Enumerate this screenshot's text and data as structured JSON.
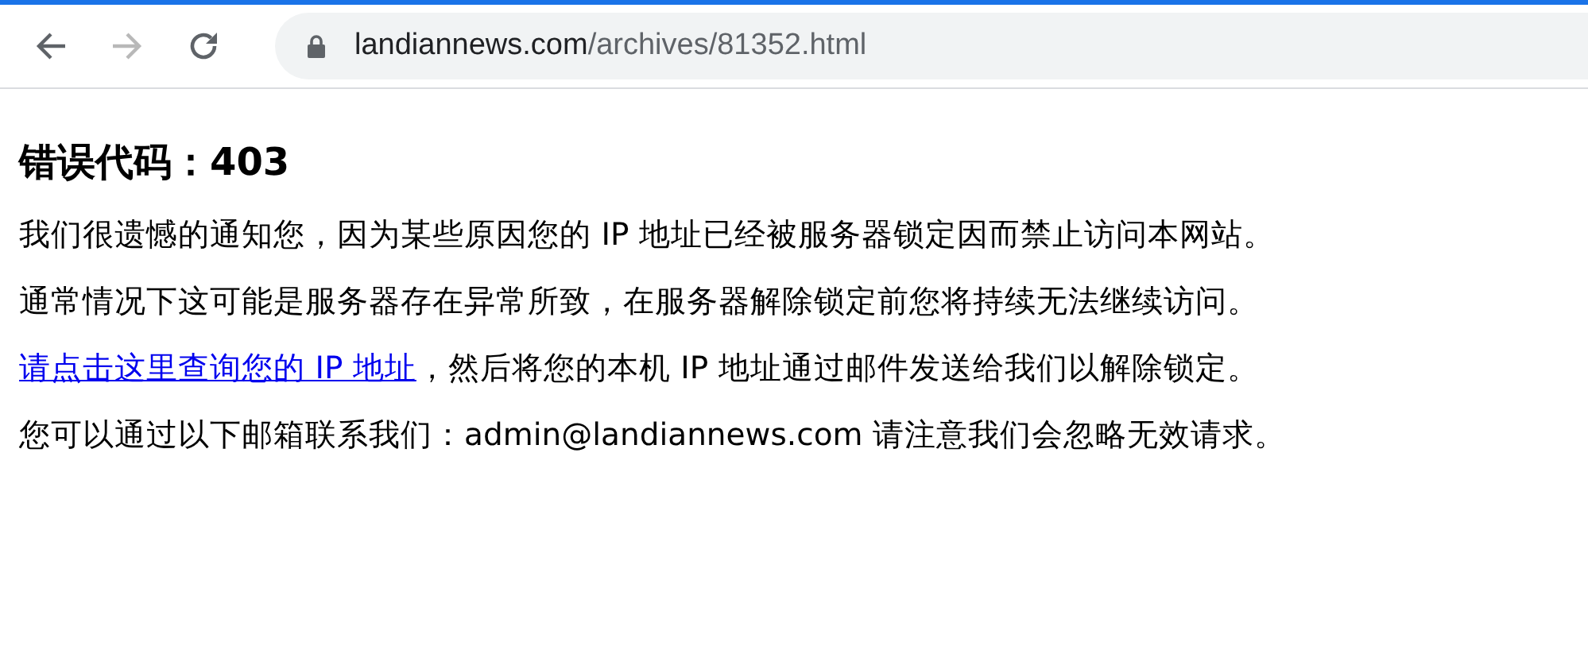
{
  "toolbar": {
    "back": {
      "disabled": false
    },
    "forward": {
      "disabled": true
    },
    "address": {
      "host": "landiannews.com",
      "path": "/archives/81352.html"
    }
  },
  "page": {
    "heading": "错误代码：403",
    "paragraphs": [
      {
        "kind": "text",
        "text": "我们很遗憾的通知您，因为某些原因您的 IP 地址已经被服务器锁定因而禁止访问本网站。"
      },
      {
        "kind": "text",
        "text": "通常情况下这可能是服务器存在异常所致，在服务器解除锁定前您将持续无法继续访问。"
      },
      {
        "kind": "link",
        "link": "请点击这里查询您的 IP 地址",
        "text": "，然后将您的本机 IP 地址通过邮件发送给我们以解除锁定。"
      },
      {
        "kind": "text",
        "text": "您可以通过以下邮箱联系我们：admin@landiannews.com 请注意我们会忽略无效请求。"
      }
    ]
  }
}
